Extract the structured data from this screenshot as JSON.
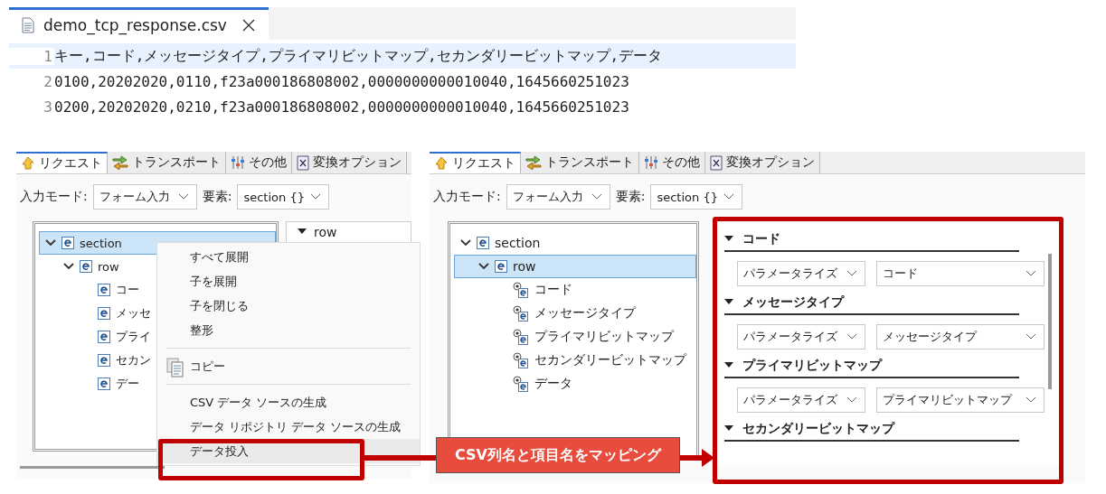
{
  "editor": {
    "tab": {
      "title": "demo_tcp_response.csv",
      "selected": true
    },
    "lines": [
      {
        "number": "1",
        "text": "キー,コード,メッセージタイプ,プライマリビットマップ,セカンダリービットマップ,データ",
        "highlighted": true
      },
      {
        "number": "2",
        "text": "0100,20202020,0110,f23a000186808002,0000000000010040,1645660251023",
        "highlighted": false
      },
      {
        "number": "3",
        "text": "0200,20202020,0210,f23a000186808002,0000000000010040,1645660251023",
        "highlighted": false
      }
    ]
  },
  "left_panel": {
    "tabs": [
      {
        "label": "リクエスト",
        "selected": true
      },
      {
        "label": "トランスポート",
        "selected": false
      },
      {
        "label": "その他",
        "selected": false
      },
      {
        "label": "変換オプション",
        "selected": false
      }
    ],
    "mode_label": "入力モード:",
    "mode_value": "フォーム入力",
    "element_label": "要素:",
    "element_value": "section {}",
    "tree": [
      {
        "label": "section",
        "kind": "element",
        "expanded": true,
        "selected": true,
        "children": [
          {
            "label": "row",
            "kind": "element",
            "expanded": true,
            "selected": false,
            "children": [
              {
                "label": "コー",
                "kind": "element",
                "selected": false
              },
              {
                "label": "メッセ",
                "kind": "element",
                "selected": false
              },
              {
                "label": "プライ",
                "kind": "element",
                "selected": false
              },
              {
                "label": "セカン",
                "kind": "element",
                "selected": false
              },
              {
                "label": "デー",
                "kind": "element",
                "selected": false
              }
            ]
          }
        ]
      }
    ],
    "detail_title": "row",
    "context_menu": [
      {
        "kind": "item",
        "label": "すべて展開",
        "highlighted": false
      },
      {
        "kind": "item",
        "label": "子を展開",
        "highlighted": false
      },
      {
        "kind": "item",
        "label": "子を閉じる",
        "highlighted": false
      },
      {
        "kind": "item",
        "label": "整形",
        "highlighted": false
      },
      {
        "kind": "separator"
      },
      {
        "kind": "icon_item",
        "label": "コピー",
        "highlighted": false
      },
      {
        "kind": "separator"
      },
      {
        "kind": "item",
        "label": "CSV データ ソースの生成",
        "highlighted": false
      },
      {
        "kind": "item",
        "label": "データ リポジトリ データ ソースの生成",
        "highlighted": false
      },
      {
        "kind": "item",
        "label": "データ投入",
        "highlighted": true
      }
    ]
  },
  "right_panel": {
    "tabs": [
      {
        "label": "リクエスト",
        "selected": true
      },
      {
        "label": "トランスポート",
        "selected": false
      },
      {
        "label": "その他",
        "selected": false
      },
      {
        "label": "変換オプション",
        "selected": false
      }
    ],
    "mode_label": "入力モード:",
    "mode_value": "フォーム入力",
    "element_label": "要素:",
    "element_value": "section {}",
    "tree": [
      {
        "label": "section",
        "kind": "element",
        "expanded": true,
        "selected": false,
        "children": [
          {
            "label": "row",
            "kind": "element",
            "expanded": true,
            "selected": true,
            "children": [
              {
                "label": "コード",
                "kind": "field",
                "selected": false
              },
              {
                "label": "メッセージタイプ",
                "kind": "field",
                "selected": false
              },
              {
                "label": "プライマリビットマップ",
                "kind": "field",
                "selected": false
              },
              {
                "label": "セカンダリービットマップ",
                "kind": "field",
                "selected": false
              },
              {
                "label": "データ",
                "kind": "field",
                "selected": false
              }
            ]
          }
        ]
      }
    ],
    "sections": [
      {
        "title": "コード",
        "expanded": true,
        "mode": "パラメータライズ",
        "value": "コード"
      },
      {
        "title": "メッセージタイプ",
        "expanded": true,
        "mode": "パラメータライズ",
        "value": "メッセージタイプ"
      },
      {
        "title": "プライマリビットマップ",
        "expanded": true,
        "mode": "パラメータライズ",
        "value": "プライマリビットマップ"
      },
      {
        "title": "セカンダリービットマップ",
        "expanded": true
      }
    ]
  },
  "annotation": {
    "label": "CSV列名と項目名をマッピング"
  }
}
